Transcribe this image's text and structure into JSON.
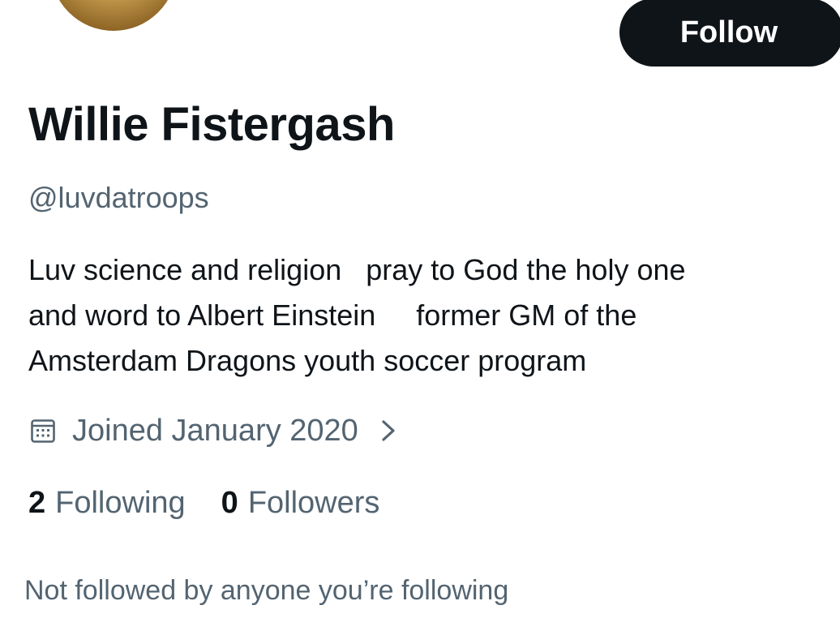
{
  "profile": {
    "follow_label": "Follow",
    "display_name": "Willie Fistergash",
    "handle": "@luvdatroops",
    "bio_lines": [
      "Luv science and religion   pray to God the holy one",
      "and word to Albert Einstein     former GM of the",
      "Amsterdam Dragons youth soccer program"
    ],
    "joined": "Joined January 2020",
    "following_count": "2",
    "following_label": "Following",
    "followers_count": "0",
    "followers_label": "Followers",
    "not_followed_text": "Not followed by anyone you’re following"
  },
  "colors": {
    "primary_text": "#0f1419",
    "secondary_text": "#536471",
    "button_bg": "#0f1419",
    "button_text": "#ffffff",
    "background": "#ffffff"
  },
  "icons": {
    "joined": "calendar-icon",
    "joined_more": "chevron-right-icon"
  }
}
